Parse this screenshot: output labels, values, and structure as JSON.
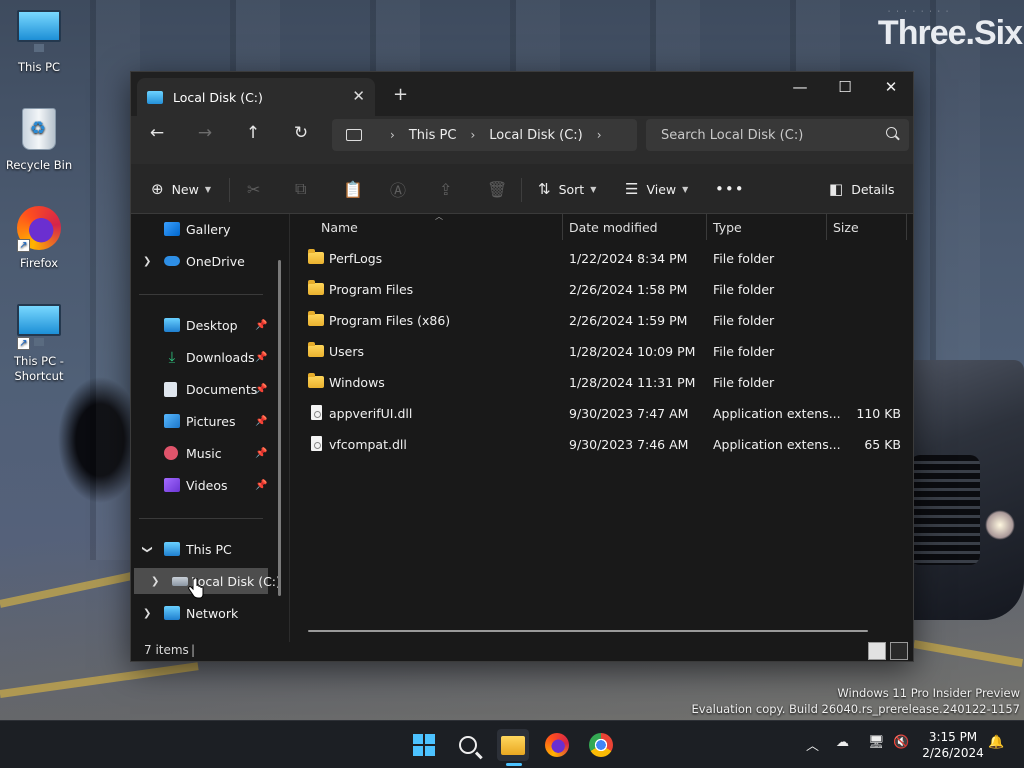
{
  "desktop": {
    "brand": "Three.Six",
    "icons": [
      {
        "label": "This PC"
      },
      {
        "label": "Recycle Bin"
      },
      {
        "label": "Firefox"
      },
      {
        "label": "This PC - Shortcut"
      }
    ],
    "watermark_line1": "Windows 11 Pro Insider Preview",
    "watermark_line2": "Evaluation copy. Build 26040.rs_prerelease.240122-1157"
  },
  "window": {
    "tab_title": "Local Disk (C:)",
    "new_tab": "+",
    "controls": {
      "minimize": "—",
      "maximize": "☐",
      "close": "✕"
    },
    "nav": {
      "back": "←",
      "forward": "→",
      "up": "↑",
      "refresh": "↻"
    },
    "breadcrumb": [
      "This PC",
      "Local Disk (C:)"
    ],
    "search_placeholder": "Search Local Disk (C:)",
    "commands": {
      "new": "New",
      "sort": "Sort",
      "view": "View",
      "more": "•••",
      "details": "Details"
    },
    "sidebar": {
      "gallery": "Gallery",
      "onedrive": "OneDrive",
      "quick": [
        "Desktop",
        "Downloads",
        "Documents",
        "Pictures",
        "Music",
        "Videos"
      ],
      "thispc": "This PC",
      "localdisk": "Local Disk (C:)",
      "network": "Network"
    },
    "columns": {
      "name": "Name",
      "date": "Date modified",
      "type": "Type",
      "size": "Size"
    },
    "files": [
      {
        "name": "PerfLogs",
        "date": "1/22/2024 8:34 PM",
        "type": "File folder",
        "size": "",
        "kind": "folder"
      },
      {
        "name": "Program Files",
        "date": "2/26/2024 1:58 PM",
        "type": "File folder",
        "size": "",
        "kind": "folder"
      },
      {
        "name": "Program Files (x86)",
        "date": "2/26/2024 1:59 PM",
        "type": "File folder",
        "size": "",
        "kind": "folder"
      },
      {
        "name": "Users",
        "date": "1/28/2024 10:09 PM",
        "type": "File folder",
        "size": "",
        "kind": "folder"
      },
      {
        "name": "Windows",
        "date": "1/28/2024 11:31 PM",
        "type": "File folder",
        "size": "",
        "kind": "folder"
      },
      {
        "name": "appverifUI.dll",
        "date": "9/30/2023 7:47 AM",
        "type": "Application extens...",
        "size": "110 KB",
        "kind": "dll"
      },
      {
        "name": "vfcompat.dll",
        "date": "9/30/2023 7:46 AM",
        "type": "Application extens...",
        "size": "65 KB",
        "kind": "dll"
      }
    ],
    "status_count": "7 items"
  },
  "taskbar": {
    "time": "3:15 PM",
    "date": "2/26/2024",
    "accent": "#4cc2ff"
  }
}
